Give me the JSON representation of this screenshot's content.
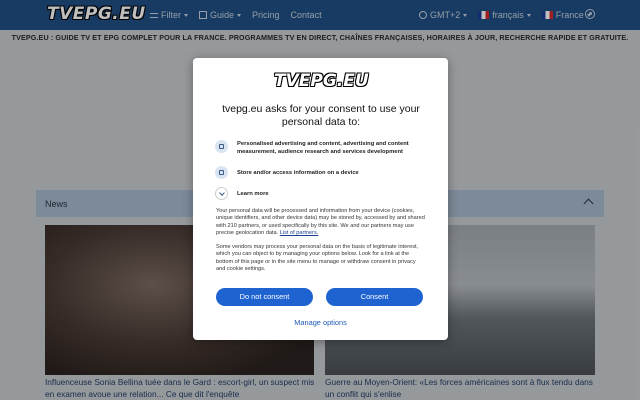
{
  "header": {
    "logo": "TVEPG.EU",
    "nav": {
      "filter": "Filter",
      "guide": "Guide",
      "pricing": "Pricing",
      "contact": "Contact"
    },
    "timezone": "GMT+2",
    "language": "français",
    "country": "France"
  },
  "tagline": "TVEPG.EU : GUIDE TV ET EPG COMPLET POUR LA FRANCE. PROGRAMMES TV EN DIRECT, CHAÎNES FRANÇAISES, HORAIRES À JOUR, RECHERCHE RAPIDE ET GRATUITE.",
  "news": {
    "title": "News",
    "articles": [
      {
        "caption": "Influenceuse Sonia Bellina tuée dans le Gard : escort-girl, un suspect mis en examen avoue une relation... Ce que dit l'enquête"
      },
      {
        "caption": "Guerre au Moyen-Orient: «Les forces américaines sont à flux tendu dans un conflit qui s'enlise"
      }
    ]
  },
  "consent": {
    "logo": "TVEPG.EU",
    "title": "tvepg.eu asks for your consent to use your personal data to:",
    "purposes": [
      {
        "icon": "person-icon",
        "text": "Personalised advertising and content, advertising and content measurement, audience research and services development"
      },
      {
        "icon": "device-icon",
        "text": "Store and/or access information on a device"
      }
    ],
    "learn_more": "Learn more",
    "paragraph1": "Your personal data will be processed and information from your device (cookies, unique identifiers, and other device data) may be stored by, accessed by and shared with 210 partners, or used specifically by this site. We and our partners may use precise geolocation data.",
    "partners_link": "List of partners.",
    "paragraph2": "Some vendors may process your personal data on the basis of legitimate interest, which you can object to by managing your options below. Look for a link at the bottom of this page or in the site menu to manage or withdraw consent in privacy and cookie settings.",
    "do_not_consent": "Do not consent",
    "consent": "Consent",
    "manage_options": "Manage options"
  }
}
